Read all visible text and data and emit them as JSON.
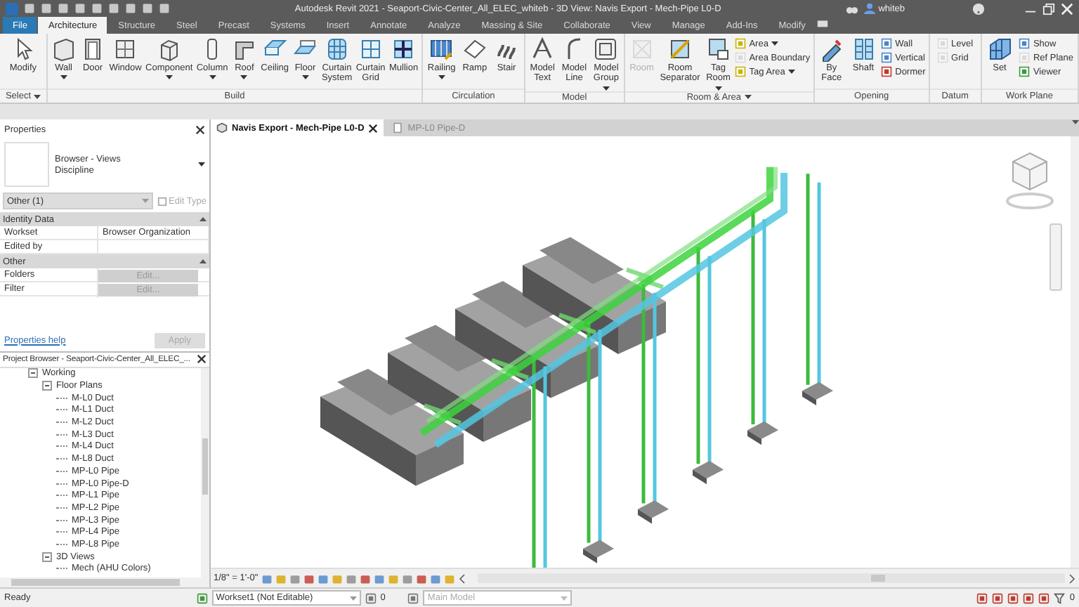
{
  "title_bar": {
    "title": "Autodesk Revit 2021 - Seaport-Civic-Center_All_ELEC_whiteb - 3D View: Navis Export - Mech-Pipe L0-D",
    "user": "whiteb"
  },
  "ribbon_tabs": [
    {
      "label": "File",
      "kind": "file",
      "selected": false
    },
    {
      "label": "Architecture",
      "kind": "tab",
      "selected": true
    },
    {
      "label": "Structure",
      "kind": "tab",
      "selected": false
    },
    {
      "label": "Steel",
      "kind": "tab",
      "selected": false
    },
    {
      "label": "Precast",
      "kind": "tab",
      "selected": false
    },
    {
      "label": "Systems",
      "kind": "tab",
      "selected": false
    },
    {
      "label": "Insert",
      "kind": "tab",
      "selected": false
    },
    {
      "label": "Annotate",
      "kind": "tab",
      "selected": false
    },
    {
      "label": "Analyze",
      "kind": "tab",
      "selected": false
    },
    {
      "label": "Massing & Site",
      "kind": "tab",
      "selected": false
    },
    {
      "label": "Collaborate",
      "kind": "tab",
      "selected": false
    },
    {
      "label": "View",
      "kind": "tab",
      "selected": false
    },
    {
      "label": "Manage",
      "kind": "tab",
      "selected": false
    },
    {
      "label": "Add-Ins",
      "kind": "tab",
      "selected": false
    },
    {
      "label": "Modify",
      "kind": "tab",
      "selected": false
    }
  ],
  "ribbon_panels": [
    {
      "title": "Select",
      "menu": true,
      "tools": [
        {
          "kind": "large",
          "label": "Modify",
          "dropdown": false,
          "disabled": false
        }
      ]
    },
    {
      "title": "Build",
      "menu": false,
      "tools": [
        {
          "kind": "large",
          "label": "Wall",
          "dropdown": true,
          "disabled": false
        },
        {
          "kind": "large",
          "label": "Door",
          "dropdown": false,
          "disabled": false
        },
        {
          "kind": "large",
          "label": "Window",
          "dropdown": false,
          "disabled": false
        },
        {
          "kind": "large",
          "label": "Component",
          "dropdown": true,
          "disabled": false
        },
        {
          "kind": "large",
          "label": "Column",
          "dropdown": true,
          "disabled": false
        },
        {
          "kind": "large",
          "label": "Roof",
          "dropdown": true,
          "disabled": false
        },
        {
          "kind": "large",
          "label": "Ceiling",
          "dropdown": false,
          "disabled": false
        },
        {
          "kind": "large",
          "label": "Floor",
          "dropdown": true,
          "disabled": false
        },
        {
          "kind": "large",
          "label": "Curtain System",
          "dropdown": false,
          "disabled": false
        },
        {
          "kind": "large",
          "label": "Curtain Grid",
          "dropdown": false,
          "disabled": false
        },
        {
          "kind": "large",
          "label": "Mullion",
          "dropdown": false,
          "disabled": false
        }
      ]
    },
    {
      "title": "Circulation",
      "menu": false,
      "tools": [
        {
          "kind": "large",
          "label": "Railing",
          "dropdown": true,
          "disabled": false
        },
        {
          "kind": "large",
          "label": "Ramp",
          "dropdown": false,
          "disabled": false
        },
        {
          "kind": "large",
          "label": "Stair",
          "dropdown": false,
          "disabled": false
        }
      ]
    },
    {
      "title": "Model",
      "menu": false,
      "tools": [
        {
          "kind": "large",
          "label": "Model Text",
          "dropdown": false,
          "disabled": false
        },
        {
          "kind": "large",
          "label": "Model Line",
          "dropdown": false,
          "disabled": false
        },
        {
          "kind": "large",
          "label": "Model Group",
          "dropdown": true,
          "disabled": false
        }
      ]
    },
    {
      "title": "Room & Area",
      "menu": true,
      "tools": [
        {
          "kind": "large",
          "label": "Room",
          "dropdown": false,
          "disabled": true
        },
        {
          "kind": "large",
          "label": "Room Separator",
          "dropdown": false,
          "disabled": false
        },
        {
          "kind": "large",
          "label": "Tag Room",
          "dropdown": true,
          "disabled": false
        },
        {
          "kind": "small",
          "label": "Area",
          "dropdown": true,
          "disabled": false
        },
        {
          "kind": "small",
          "label": "Area Boundary",
          "dropdown": false,
          "disabled": true
        },
        {
          "kind": "small",
          "label": "Tag Area",
          "dropdown": true,
          "disabled": false
        }
      ]
    },
    {
      "title": "Opening",
      "menu": false,
      "tools": [
        {
          "kind": "large",
          "label": "By Face",
          "dropdown": false,
          "disabled": false
        },
        {
          "kind": "large",
          "label": "Shaft",
          "dropdown": false,
          "disabled": false
        },
        {
          "kind": "small",
          "label": "Wall",
          "dropdown": false,
          "disabled": false
        },
        {
          "kind": "small",
          "label": "Vertical",
          "dropdown": false,
          "disabled": false
        },
        {
          "kind": "small",
          "label": "Dormer",
          "dropdown": false,
          "disabled": false
        }
      ]
    },
    {
      "title": "Datum",
      "menu": false,
      "tools": [
        {
          "kind": "small",
          "label": "Level",
          "dropdown": false,
          "disabled": true
        },
        {
          "kind": "small",
          "label": "Grid",
          "dropdown": false,
          "disabled": true
        }
      ]
    },
    {
      "title": "Work Plane",
      "menu": false,
      "tools": [
        {
          "kind": "large",
          "label": "Set",
          "dropdown": false,
          "disabled": false
        },
        {
          "kind": "small",
          "label": "Show",
          "dropdown": false,
          "disabled": false
        },
        {
          "kind": "small",
          "label": "Ref Plane",
          "dropdown": false,
          "disabled": true
        },
        {
          "kind": "small",
          "label": "Viewer",
          "dropdown": false,
          "disabled": false
        }
      ]
    }
  ],
  "properties": {
    "title": "Properties",
    "type_name": "Browser - Views",
    "type_detail": "Discipline",
    "filter": "Other (1)",
    "edit_type": {
      "label": "Edit Type",
      "disabled": true
    },
    "sections": [
      {
        "title": "Identity Data",
        "expanded": true,
        "rows": [
          {
            "name": "Workset",
            "kind": "text",
            "value": "Browser Organization"
          },
          {
            "name": "Edited by",
            "kind": "text"
          }
        ]
      },
      {
        "title": "Other",
        "expanded": true,
        "rows": [
          {
            "name": "Folders",
            "kind": "button",
            "value": "Edit..."
          },
          {
            "name": "Filter",
            "kind": "button",
            "value": "Edit..."
          }
        ]
      }
    ],
    "help_link": "Properties help",
    "apply": {
      "label": "Apply",
      "disabled": true
    }
  },
  "project_browser": {
    "title": "Project Browser - Seaport-Civic-Center_All_ELEC_...",
    "tree": [
      {
        "label": "Working",
        "expanded": true,
        "children": [
          {
            "label": "Floor Plans",
            "expanded": true,
            "children": [
              {
                "label": "M-L0 Duct"
              },
              {
                "label": "M-L1 Duct"
              },
              {
                "label": "M-L2 Duct"
              },
              {
                "label": "M-L3 Duct"
              },
              {
                "label": "M-L4 Duct"
              },
              {
                "label": "M-L8 Duct"
              },
              {
                "label": "MP-L0 Pipe"
              },
              {
                "label": "MP-L0 Pipe-D"
              },
              {
                "label": "MP-L1 Pipe"
              },
              {
                "label": "MP-L2 Pipe"
              },
              {
                "label": "MP-L3 Pipe"
              },
              {
                "label": "MP-L4 Pipe"
              },
              {
                "label": "MP-L8 Pipe"
              }
            ]
          },
          {
            "label": "3D Views",
            "expanded": true,
            "children": [
              {
                "label": "Mech (AHU Colors)"
              }
            ]
          }
        ]
      }
    ]
  },
  "view_tabs": [
    {
      "label": "Navis Export - Mech-Pipe L0-D",
      "selected": true
    },
    {
      "label": "MP-L0 Pipe-D",
      "selected": false
    }
  ],
  "view_control_bar": {
    "scale": "1/8\" = 1'-0\""
  },
  "status_bar": {
    "status": "Ready",
    "workset": "Workset1 (Not Editable)",
    "editable_count": "0",
    "design_option": {
      "value": "Main Model",
      "disabled": true
    },
    "filter_count": "0"
  }
}
